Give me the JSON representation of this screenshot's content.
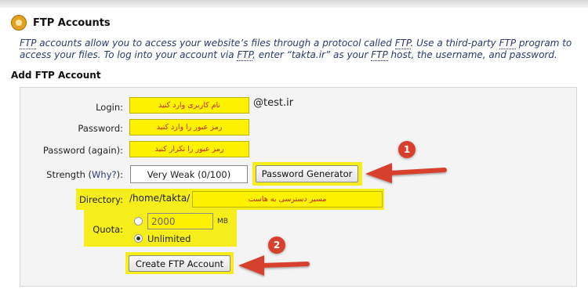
{
  "header": {
    "title": "FTP Accounts",
    "description_parts": [
      {
        "text": "FTP",
        "abbr": true
      },
      {
        "text": " accounts allow you to access your website’s files through a protocol called ",
        "abbr": false
      },
      {
        "text": "FTP",
        "abbr": true
      },
      {
        "text": ". Use a third-party ",
        "abbr": false
      },
      {
        "text": "FTP",
        "abbr": true
      },
      {
        "text": " program to access your files. To log into your account via ",
        "abbr": false
      },
      {
        "text": "FTP",
        "abbr": true
      },
      {
        "text": ", enter “takta.ir” as your ",
        "abbr": false
      },
      {
        "text": "FTP",
        "abbr": true
      },
      {
        "text": " host, the username, and password.",
        "abbr": false
      }
    ]
  },
  "form": {
    "section_title": "Add FTP Account",
    "login": {
      "label": "Login:",
      "value": "نام کاربری وارد کنید",
      "domain_suffix": "@test.ir"
    },
    "password": {
      "label": "Password:",
      "value": "رمز عبور را وارد کنید"
    },
    "password_again": {
      "label": "Password (again):",
      "value": "رمز عبور را تکرار کنید"
    },
    "strength": {
      "label": "Strength (",
      "why_link": "Why?",
      "label_end": "):",
      "value": "Very Weak (0/100)",
      "generator_button": "Password Generator"
    },
    "directory": {
      "label": "Directory:",
      "path": "/home/takta/",
      "value": "مسیر دسترسی به هاست"
    },
    "quota": {
      "label": "Quota:",
      "value": "2000",
      "unit": "MB",
      "unlimited_label": "Unlimited",
      "unlimited_selected": true
    },
    "submit_button": "Create FTP Account"
  },
  "annotations": {
    "badge_1": "1",
    "badge_2": "2",
    "arrow_color": "#d8402e",
    "highlight_color": "#fff200"
  }
}
